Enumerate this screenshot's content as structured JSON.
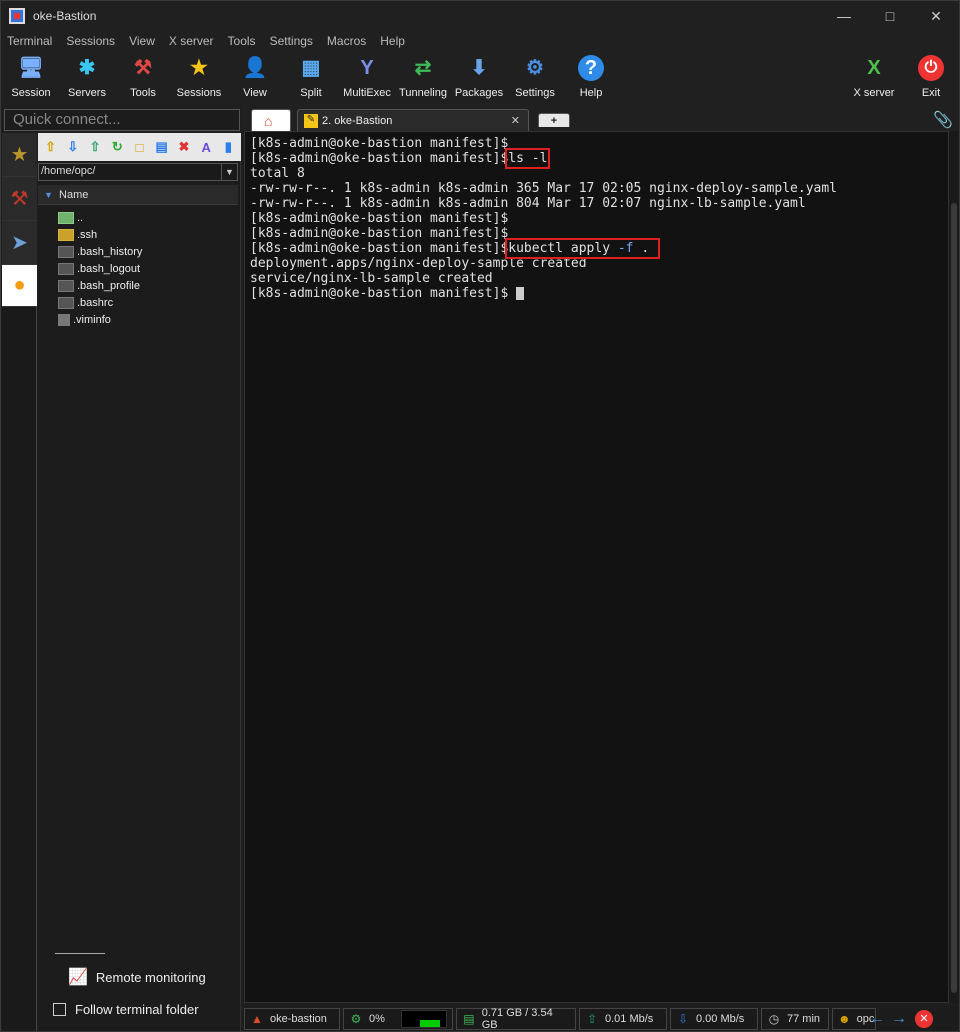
{
  "window": {
    "title": "oke-Bastion"
  },
  "menu": [
    "Terminal",
    "Sessions",
    "View",
    "X server",
    "Tools",
    "Settings",
    "Macros",
    "Help"
  ],
  "toolbar": {
    "session": "Session",
    "servers": "Servers",
    "tools": "Tools",
    "sessions": "Sessions",
    "view": "View",
    "split": "Split",
    "multiexec": "MultiExec",
    "tunneling": "Tunneling",
    "packages": "Packages",
    "settings": "Settings",
    "help": "Help",
    "xserver": "X server",
    "exit": "Exit"
  },
  "quick_connect": {
    "placeholder": "Quick connect..."
  },
  "file_browser": {
    "path": "/home/opc/",
    "column": "Name",
    "items": [
      {
        "name": "..",
        "type": "up"
      },
      {
        "name": ".ssh",
        "type": "folder"
      },
      {
        "name": ".bash_history",
        "type": "file"
      },
      {
        "name": ".bash_logout",
        "type": "file"
      },
      {
        "name": ".bash_profile",
        "type": "file"
      },
      {
        "name": ".bashrc",
        "type": "file"
      },
      {
        "name": ".viminfo",
        "type": "doc"
      }
    ],
    "remote_monitoring": "Remote monitoring",
    "follow_folder": "Follow terminal folder"
  },
  "tabs": {
    "active": "2. oke-Bastion"
  },
  "terminal": {
    "prompt": "[k8s-admin@oke-bastion manifest]$",
    "cmd1": "ls -l",
    "out_total": "total 8",
    "out_file1": "-rw-rw-r--. 1 k8s-admin k8s-admin 365 Mar 17 02:05 nginx-deploy-sample.yaml",
    "out_file2": "-rw-rw-r--. 1 k8s-admin k8s-admin 804 Mar 17 02:07 nginx-lb-sample.yaml",
    "cmd2_a": "kubectl apply ",
    "cmd2_b": "-f",
    "cmd2_c": " .",
    "out_deploy": "deployment.apps/nginx-deploy-sample created",
    "out_svc": "service/nginx-lb-sample created"
  },
  "status": {
    "host": "oke-bastion",
    "cpu": "0%",
    "memory": "0.71 GB / 3.54 GB",
    "upload": "0.01 Mb/s",
    "download": "0.00 Mb/s",
    "uptime": "77 min",
    "user": "opc"
  },
  "colors": {
    "highlight": "#e02020",
    "accent": "#2f6fd8"
  }
}
